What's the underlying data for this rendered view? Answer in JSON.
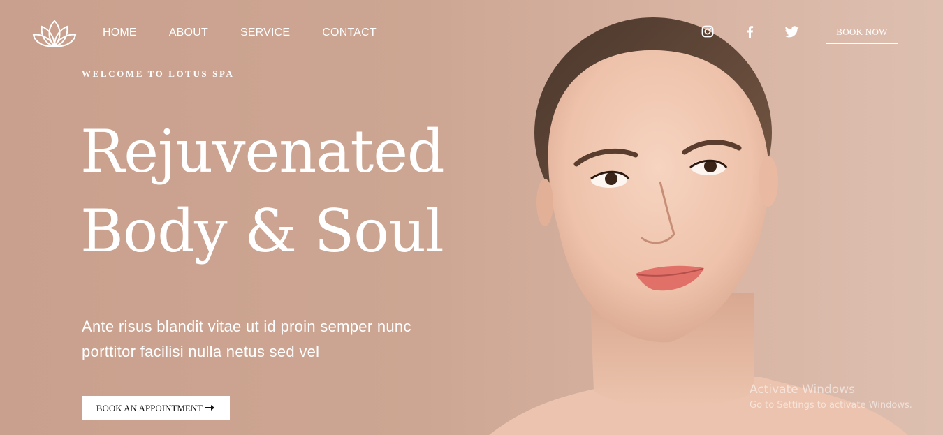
{
  "header": {
    "nav": [
      {
        "label": "HOME"
      },
      {
        "label": "ABOUT"
      },
      {
        "label": "SERVICE"
      },
      {
        "label": "CONTACT"
      }
    ],
    "social": [
      "instagram-icon",
      "facebook-icon",
      "twitter-icon"
    ],
    "book_now_label": "BOOK NOW"
  },
  "hero": {
    "eyebrow": "WELCOME TO LOTUS SPA",
    "headline_line1": "Rejuvenated",
    "headline_line2": "Body & Soul",
    "lead": "Ante risus blandit vitae ut id proin semper nunc porttitor facilisi nulla netus sed vel",
    "cta_label": "BOOK AN APPOINTMENT",
    "cta_icon": "arrow-right-icon"
  },
  "watermark": {
    "title": "Activate Windows",
    "subtitle": "Go to Settings to activate Windows."
  },
  "colors": {
    "background": "#cda693",
    "text": "#ffffff",
    "cta_bg": "#ffffff",
    "cta_text": "#111111",
    "lips": "#e07068"
  }
}
